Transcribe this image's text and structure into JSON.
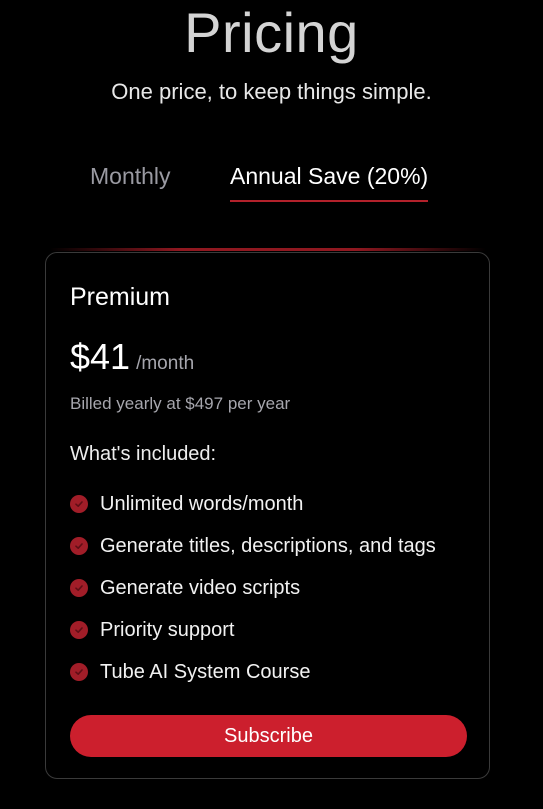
{
  "header": {
    "title": "Pricing",
    "subtitle": "One price, to keep things simple."
  },
  "billing_tabs": {
    "monthly_label": "Monthly",
    "annual_label": "Annual Save (20%)",
    "selected": "annual"
  },
  "plan": {
    "name": "Premium",
    "price": "$41",
    "period": "/month",
    "billing_note": "Billed yearly at $497 per year",
    "included_heading": "What's included:",
    "features": [
      {
        "label": "Unlimited words/month",
        "icon": "check-circle-icon"
      },
      {
        "label": "Generate titles, descriptions, and tags",
        "icon": "check-circle-icon"
      },
      {
        "label": "Generate video scripts",
        "icon": "check-circle-icon"
      },
      {
        "label": "Priority support",
        "icon": "check-circle-icon"
      },
      {
        "label": "Tube AI System Course",
        "icon": "check-circle-icon"
      }
    ],
    "cta_label": "Subscribe"
  },
  "colors": {
    "background": "#000000",
    "accent": "#cc1f2d",
    "check": "#a11d28",
    "muted_text": "#a6a6ad",
    "card_border": "#3a3a3a"
  }
}
